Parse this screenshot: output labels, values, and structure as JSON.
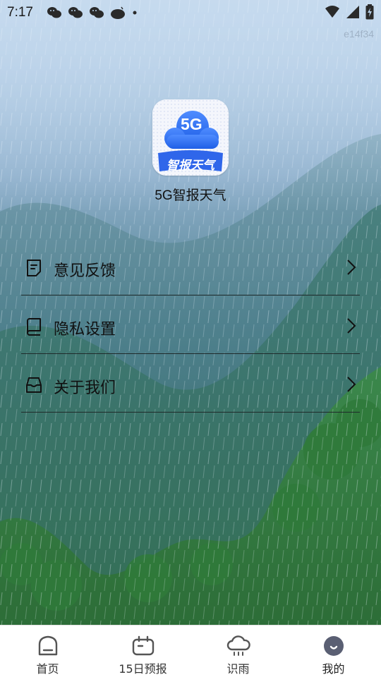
{
  "status_bar": {
    "time": "7:17",
    "left_icons": [
      "wechat-icon",
      "wechat-icon",
      "wechat-icon",
      "weather-cloud-icon",
      "dot-icon"
    ],
    "right_icons": [
      "wifi-icon",
      "cell-signal-icon",
      "battery-charging-icon"
    ]
  },
  "build_tag": "e14f34",
  "app": {
    "logo_text_top": "5G",
    "logo_text_bottom": "智报天气",
    "name": "5G智报天气"
  },
  "menu": {
    "items": [
      {
        "label": "意见反馈",
        "icon": "feedback-note-icon"
      },
      {
        "label": "隐私设置",
        "icon": "privacy-book-icon"
      },
      {
        "label": "关于我们",
        "icon": "about-box-icon"
      }
    ]
  },
  "bottom_nav": {
    "items": [
      {
        "label": "首页",
        "icon": "home-icon",
        "active": false
      },
      {
        "label": "15日预报",
        "icon": "calendar-forecast-icon",
        "active": false
      },
      {
        "label": "识雨",
        "icon": "rain-cloud-icon",
        "active": false
      },
      {
        "label": "我的",
        "icon": "profile-icon",
        "active": true
      }
    ]
  },
  "colors": {
    "nav_active": "#5a5f73",
    "nav_inactive": "#555555",
    "logo_blue": "#2f6ef2",
    "text_dark": "#111111"
  }
}
